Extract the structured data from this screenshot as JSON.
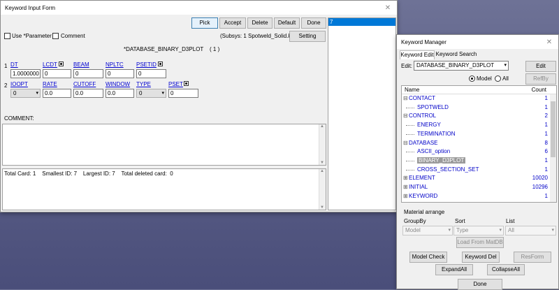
{
  "kif": {
    "title": "Keyword Input Form",
    "buttons": {
      "pick": "Pick",
      "accept": "Accept",
      "delete": "Delete",
      "default": "Default",
      "done": "Done",
      "setting": "Setting"
    },
    "use_param": "Use *Parameter",
    "comment_check": "Comment",
    "subsys": "(Subsys: 1 Spotweld_Solid.k)",
    "heading": "*DATABASE_BINARY_D3PLOT    ( 1 )",
    "row1_num": "1",
    "row2_num": "2",
    "row1": [
      {
        "label": "DT",
        "value": "1.0000000"
      },
      {
        "label": "LCDT",
        "value": "0"
      },
      {
        "label": "BEAM",
        "value": "0"
      },
      {
        "label": "NPLTC",
        "value": "0"
      },
      {
        "label": "PSETID",
        "value": "0"
      }
    ],
    "row2": [
      {
        "label": "IOOPT",
        "value": "0"
      },
      {
        "label": "RATE",
        "value": "0.0"
      },
      {
        "label": "CUTOFF",
        "value": "0.0"
      },
      {
        "label": "WINDOW",
        "value": "0.0"
      },
      {
        "label": "TYPE",
        "value": "0"
      },
      {
        "label": "PSET",
        "value": "0"
      }
    ],
    "comment_label": "COMMENT:",
    "status": "Total Card: 1    Smallest ID: 7    Largest ID: 7    Total deleted card:  0",
    "id_list": [
      "7"
    ]
  },
  "km": {
    "title": "Keyword Manager",
    "tabs": [
      "Keyword Edit",
      "Keyword Search"
    ],
    "edit_label": "Edit:",
    "edit_value": "DATABASE_BINARY_D3PLOT",
    "edit_btn": "Edit",
    "radio_model": "Model",
    "radio_all": "All",
    "refby": "RefBy",
    "col_name": "Name",
    "col_count": "Count",
    "tree": [
      {
        "name": "CONTACT",
        "count": "1",
        "level": 0,
        "sign": "-"
      },
      {
        "name": "SPOTWELD",
        "count": "1",
        "level": 1
      },
      {
        "name": "CONTROL",
        "count": "2",
        "level": 0,
        "sign": "-"
      },
      {
        "name": "ENERGY",
        "count": "1",
        "level": 1
      },
      {
        "name": "TERMINATION",
        "count": "1",
        "level": 1
      },
      {
        "name": "DATABASE",
        "count": "8",
        "level": 0,
        "sign": "-"
      },
      {
        "name": "ASCII_option",
        "count": "6",
        "level": 1
      },
      {
        "name": "BINARY_D3PLOT",
        "count": "1",
        "level": 1,
        "selected": true
      },
      {
        "name": "CROSS_SECTION_SET",
        "count": "1",
        "level": 1
      },
      {
        "name": "ELEMENT",
        "count": "10020",
        "level": 0,
        "sign": "+"
      },
      {
        "name": "INITIAL",
        "count": "10296",
        "level": 0,
        "sign": "+"
      },
      {
        "name": "KEYWORD",
        "count": "1",
        "level": 0,
        "sign": "+"
      }
    ],
    "material_arrange": "Material arrange",
    "groupby_label": "GroupBy",
    "sort_label": "Sort",
    "list_label": "List",
    "groupby_value": "Model",
    "sort_value": "Type",
    "list_value": "All",
    "load_matdb": "Load From MatDB",
    "model_check": "Model Check",
    "keyword_del": "Keyword Del",
    "resform": "ResForm",
    "expand_all": "ExpandAll",
    "collapse_all": "CollapseAll",
    "done": "Done"
  }
}
